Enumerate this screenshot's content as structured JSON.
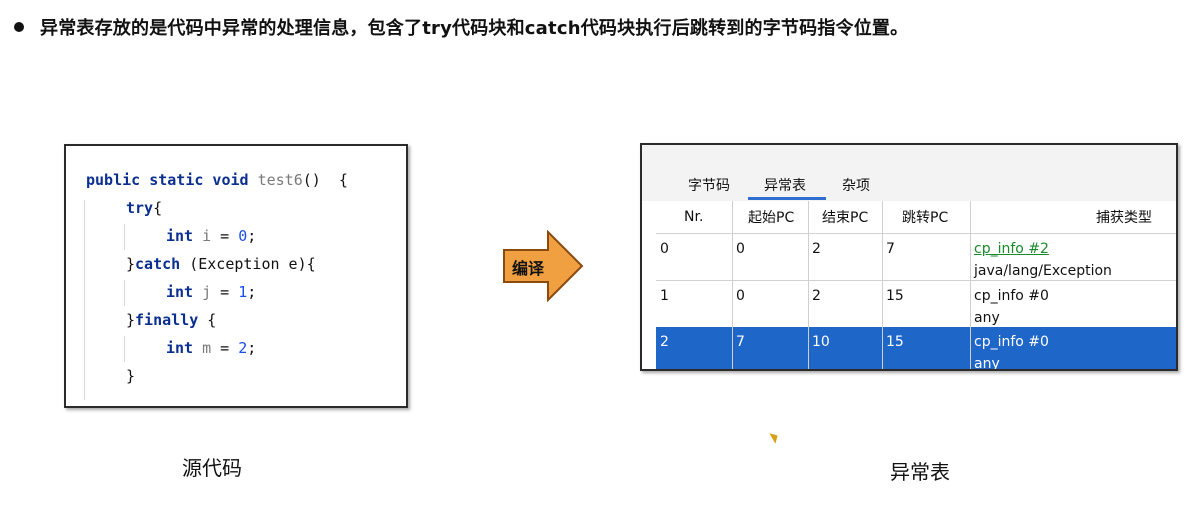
{
  "headline": "异常表存放的是代码中异常的处理信息，包含了try代码块和catch代码块执行后跳转到的字节码指令位置。",
  "source": {
    "line1": {
      "kw": "public static void ",
      "fn": "test6",
      "rest": "()  {"
    },
    "line2": {
      "kw": "try",
      "rest": "{"
    },
    "line3": {
      "kw": "int ",
      "var": "i",
      "mid": " = ",
      "num": "0",
      "rest": ";"
    },
    "line4": {
      "pre": "}",
      "kw": "catch",
      "rest": " (Exception e){"
    },
    "line5": {
      "kw": "int ",
      "var": "j",
      "mid": " = ",
      "num": "1",
      "rest": ";"
    },
    "line6": {
      "pre": "}",
      "kw": "finally",
      "rest": " {"
    },
    "line7": {
      "kw": "int ",
      "var": "m",
      "mid": " = ",
      "num": "2",
      "rest": ";"
    },
    "line8": {
      "rest": "}"
    },
    "caption": "源代码"
  },
  "arrow_label": "编译",
  "table": {
    "tabs": [
      "字节码",
      "异常表",
      "杂项"
    ],
    "active_tab": "异常表",
    "headers": [
      "Nr.",
      "起始PC",
      "结束PC",
      "跳转PC",
      "捕获类型"
    ],
    "rows": [
      {
        "nr": "0",
        "start": "0",
        "end": "2",
        "handler": "7",
        "type_ref": "cp_info #2",
        "type_name": "java/lang/Exception"
      },
      {
        "nr": "1",
        "start": "0",
        "end": "2",
        "handler": "15",
        "type_ref": "cp_info #0",
        "type_name": "any"
      },
      {
        "nr": "2",
        "start": "7",
        "end": "10",
        "handler": "15",
        "type_ref": "cp_info #0",
        "type_name": "any"
      }
    ],
    "selected_row": "2",
    "caption": "异常表"
  },
  "colors": {
    "selection": "#1e66c8",
    "link": "#1a8a2a",
    "arrow_fill": "#f0a040",
    "keyword": "#0b2f8f"
  }
}
